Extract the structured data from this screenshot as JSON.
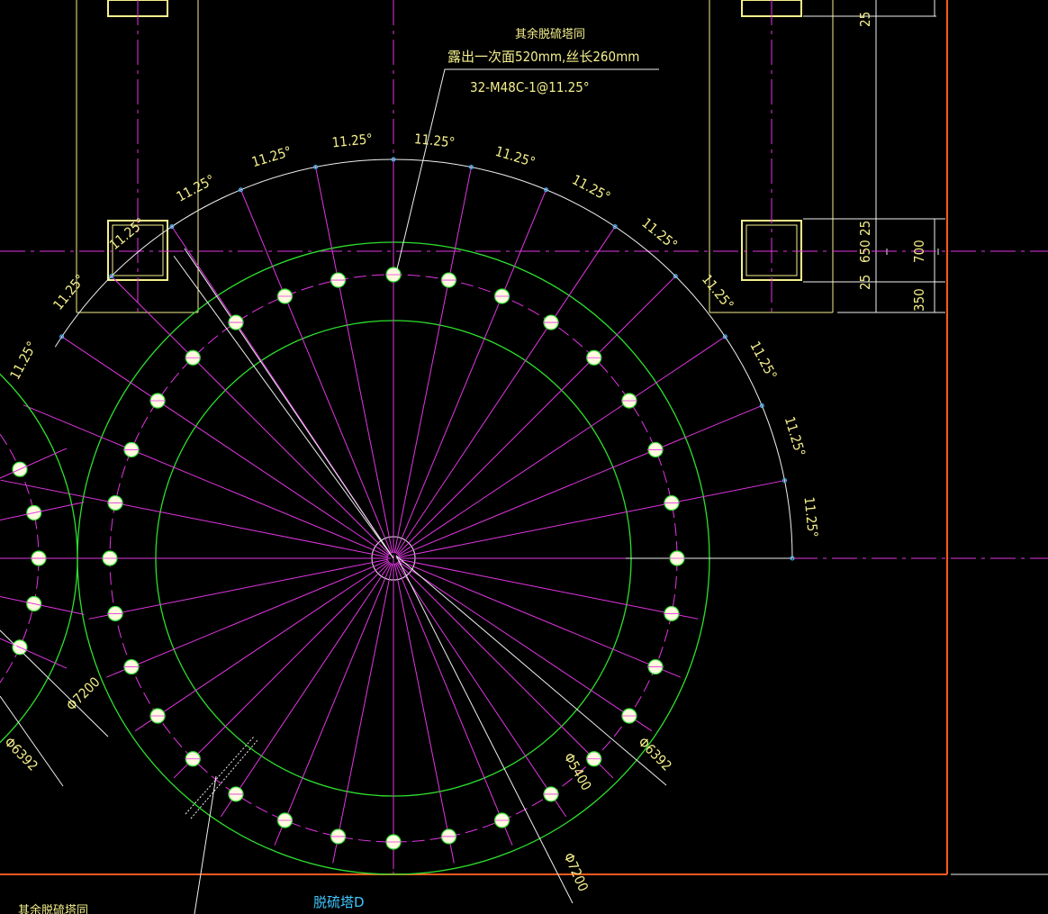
{
  "title_label": "脱硫塔D",
  "leader_note": {
    "line1": "其余脱硫塔同",
    "line2": "露出一次面520mm,丝长260mm",
    "line3": "32-M48C-1@11.25°"
  },
  "bottom_left_note": "其余脱硫塔同",
  "angle_label": "11.25°",
  "diameters": {
    "outer_left": "Φ7200",
    "outer_right": "Φ7200",
    "bolt_left": "Φ6392",
    "bolt_right": "Φ6392",
    "inner": "Φ5400"
  },
  "dimensions": {
    "d25_top": "25",
    "d25a": "25",
    "d650": "650",
    "d25b": "25",
    "d700": "700",
    "d350": "350"
  },
  "bolt_count": 32,
  "bolt_spacing_deg": 11.25,
  "colors": {
    "background": "#000000",
    "green": "#2ee02e",
    "magenta": "#e236e2",
    "white": "#f0f0f0",
    "yellow": "#f5f08c",
    "orange": "#ff5a1f",
    "cyan": "#3fc8ff"
  }
}
